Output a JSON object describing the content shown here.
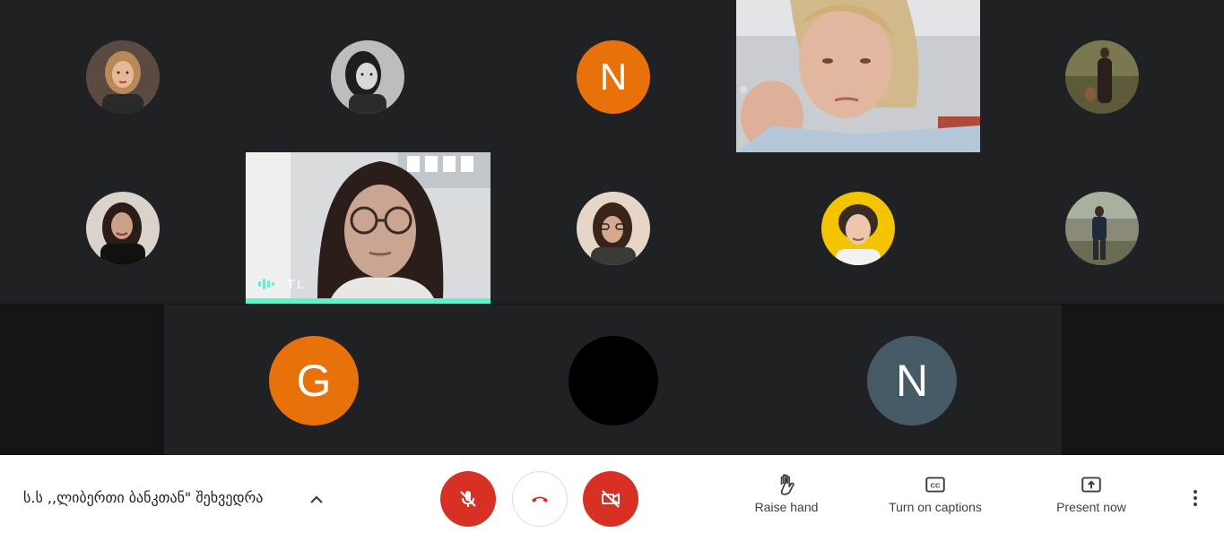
{
  "participants": {
    "top_row": [
      {
        "type": "photo",
        "icon": "person-avatar-icon"
      },
      {
        "type": "photo",
        "icon": "person-avatar-icon"
      },
      {
        "type": "letter",
        "initial": "N",
        "color": "#e8710a"
      },
      {
        "type": "video"
      },
      {
        "type": "photo",
        "icon": "person-avatar-icon"
      }
    ],
    "middle_row": [
      {
        "type": "photo",
        "icon": "person-avatar-icon"
      },
      {
        "type": "video",
        "name_tag": "TL",
        "speaking": true
      },
      {
        "type": "photo",
        "icon": "person-avatar-icon"
      },
      {
        "type": "photo",
        "icon": "person-avatar-icon"
      },
      {
        "type": "photo",
        "icon": "person-avatar-icon"
      }
    ],
    "bottom_row": [
      {
        "type": "letter",
        "initial": "G",
        "color": "#e8710a"
      },
      {
        "type": "blank",
        "color": "#000000"
      },
      {
        "type": "letter",
        "initial": "N",
        "color": "#455a64"
      }
    ]
  },
  "video_tile": {
    "name_tag": "TL"
  },
  "toolbar": {
    "meeting_title": "ს.ს ,,ლიბერთი ბანკთან\" შეხვედრა",
    "mic_icon": "mic-off-icon",
    "hangup_icon": "call-end-icon",
    "camera_icon": "videocam-off-icon",
    "raise_hand_label": "Raise hand",
    "captions_label": "Turn on captions",
    "present_label": "Present now",
    "colors": {
      "danger": "#d93025",
      "speaking": "#5ef2c8",
      "text": "#3c4043"
    }
  }
}
